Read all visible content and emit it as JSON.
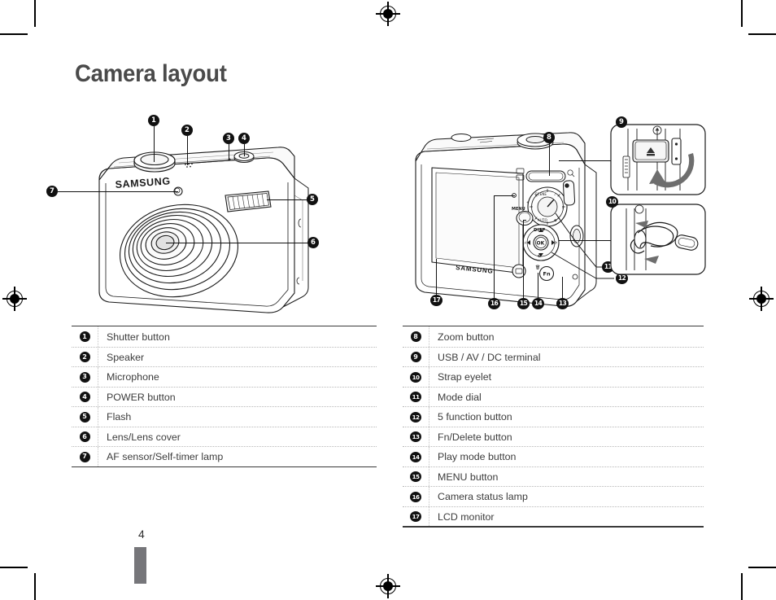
{
  "page": {
    "title": "Camera layout",
    "page_number": "4",
    "brand_logo": "SAMSUNG"
  },
  "figures": {
    "front": {
      "name": "camera-front-view",
      "callouts": [
        "1",
        "2",
        "3",
        "4",
        "5",
        "6",
        "7"
      ]
    },
    "rear": {
      "name": "camera-rear-view",
      "callouts": [
        "8",
        "11",
        "12",
        "13",
        "14",
        "15",
        "16",
        "17"
      ]
    },
    "inset_terminal": {
      "name": "usb-av-dc-terminal-detail",
      "callout": "9"
    },
    "inset_strap": {
      "name": "strap-eyelet-detail",
      "callout": "10"
    },
    "dial_labels": {
      "menu": "MENU",
      "disp": "DISP",
      "ok": "OK",
      "fn": "Fn"
    }
  },
  "table_left": {
    "rows": [
      {
        "num": "1",
        "label": "Shutter button"
      },
      {
        "num": "2",
        "label": "Speaker"
      },
      {
        "num": "3",
        "label": "Microphone"
      },
      {
        "num": "4",
        "label": "POWER button"
      },
      {
        "num": "5",
        "label": "Flash"
      },
      {
        "num": "6",
        "label": "Lens/Lens cover"
      },
      {
        "num": "7",
        "label": "AF sensor/Self-timer lamp"
      }
    ]
  },
  "table_right": {
    "rows": [
      {
        "num": "8",
        "label": "Zoom button"
      },
      {
        "num": "9",
        "label": "USB / AV / DC terminal"
      },
      {
        "num": "10",
        "label": "Strap eyelet"
      },
      {
        "num": "11",
        "label": "Mode dial"
      },
      {
        "num": "12",
        "label": "5 function button"
      },
      {
        "num": "13",
        "label": "Fn/Delete button"
      },
      {
        "num": "14",
        "label": "Play mode button"
      },
      {
        "num": "15",
        "label": "MENU button"
      },
      {
        "num": "16",
        "label": "Camera status lamp"
      },
      {
        "num": "17",
        "label": "LCD monitor"
      }
    ]
  },
  "colors": {
    "title": "#4a4a4a",
    "text": "#3c3c3c",
    "badge": "#111111",
    "tab": "#76767a",
    "rule": "#3a3a3a",
    "arrow": "#6e6e6e"
  }
}
